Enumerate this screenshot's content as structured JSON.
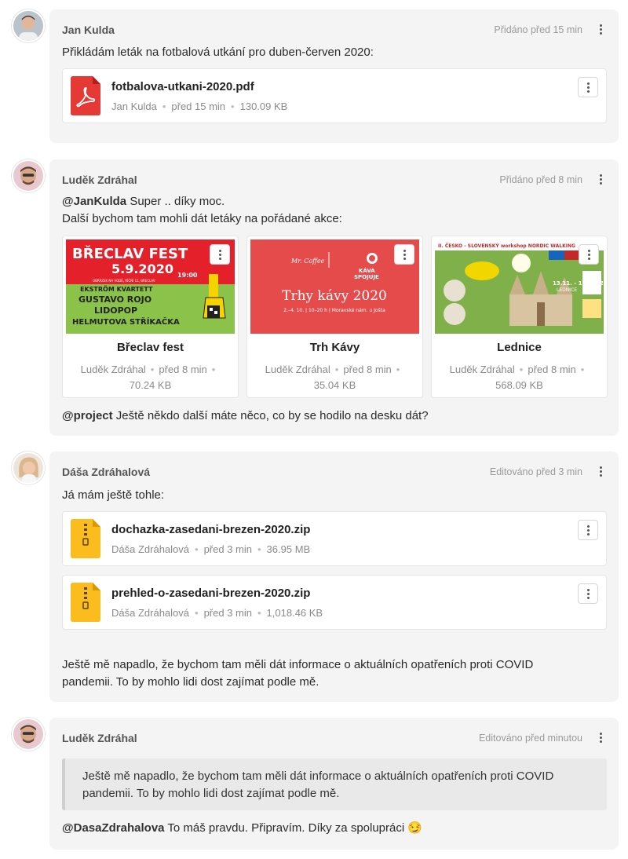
{
  "posts": [
    {
      "author": "Jan Kulda",
      "time": "Přidáno před 15 min",
      "text": "Přikládám leták na fotbalová utkání pro duben-červen 2020:",
      "files": [
        {
          "icon": "pdf-icon",
          "name": "fotbalova-utkani-2020.pdf",
          "uploader": "Jan Kulda",
          "time": "před 15 min",
          "size": "130.09 KB"
        }
      ]
    },
    {
      "author": "Luděk Zdráhal",
      "time": "Přidáno před 8 min",
      "mention1": "@JanKulda",
      "text1": " Super .. díky moc.",
      "text2": "Další bychom tam mohli dát letáky na pořádané akce:",
      "images": [
        {
          "title": "Břeclav fest",
          "uploader": "Luděk Zdráhal",
          "time": "před 8 min",
          "size": "70.24 KB",
          "thumb": {
            "headline": "BŘECLAV FEST",
            "date": "5.9.2020",
            "hour": "19:00",
            "venue": "OBRÁZEK NA VODĚ, ŘÍČNÍ 11, BŘECLAV",
            "acts": [
              "EKSTRÖM KVARTETT",
              "GUSTAVO ROJO",
              "LIDOPOP",
              "HELMUTOVA STŘÍKAČKA"
            ]
          }
        },
        {
          "title": "Trh Kávy",
          "uploader": "Luděk Zdráhal",
          "time": "před 8 min",
          "size": "35.04 KB",
          "thumb": {
            "headline": "Trhy kávy 2020",
            "sub": "2.–4. 10. | 10–20 h | Moravské nám. u Jošta",
            "logo": "KÁVA SPOJUJE",
            "brand": "Mr. Coffee"
          }
        },
        {
          "title": "Lednice",
          "uploader": "Luděk Zdráhal",
          "time": "před 8 min",
          "size": "568.09 KB",
          "thumb": {
            "headline": "II. ČESKO - SLOVENSKÝ workshop NORDIC WALKING",
            "dates": "13.11. - 15.11. 2020",
            "place": "LEDNICE"
          }
        }
      ],
      "mention2": "@project",
      "text3": " Ještě někdo další máte něco, co by se hodilo na desku dát?"
    },
    {
      "author": "Dáša Zdráhalová",
      "time": "Editováno před 3 min",
      "text": "Já mám ještě tohle:",
      "files": [
        {
          "icon": "zip-icon",
          "name": "dochazka-zasedani-brezen-2020.zip",
          "uploader": "Dáša Zdráhalová",
          "time": "před 3 min",
          "size": "36.95 MB"
        },
        {
          "icon": "zip-icon",
          "name": "prehled-o-zasedani-brezen-2020.zip",
          "uploader": "Dáša Zdráhalová",
          "time": "před 3 min",
          "size": "1,018.46 KB"
        }
      ],
      "text2a": "Ještě mě napadlo, že bychom tam měli dát informace o aktuálních opatřeních proti COVID",
      "text2b": "pandemii. To by mohlo lidi dost zajímat podle mě."
    },
    {
      "author": "Luděk Zdráhal",
      "time": "Editováno před minutou",
      "quote1": "Ještě mě napadlo, že bychom tam měli dát informace o aktuálních opatřeních proti COVID",
      "quote2": "pandemii. To by mohlo lidi dost zajímat podle mě.",
      "mention": "@DasaZdrahalova",
      "text": " To máš pravdu. Připravím. Díky za spolupráci 😏"
    }
  ],
  "colors": {
    "pdf": "#e53935",
    "zip": "#fbbd1e",
    "card_bg": "#f4f4f4"
  }
}
